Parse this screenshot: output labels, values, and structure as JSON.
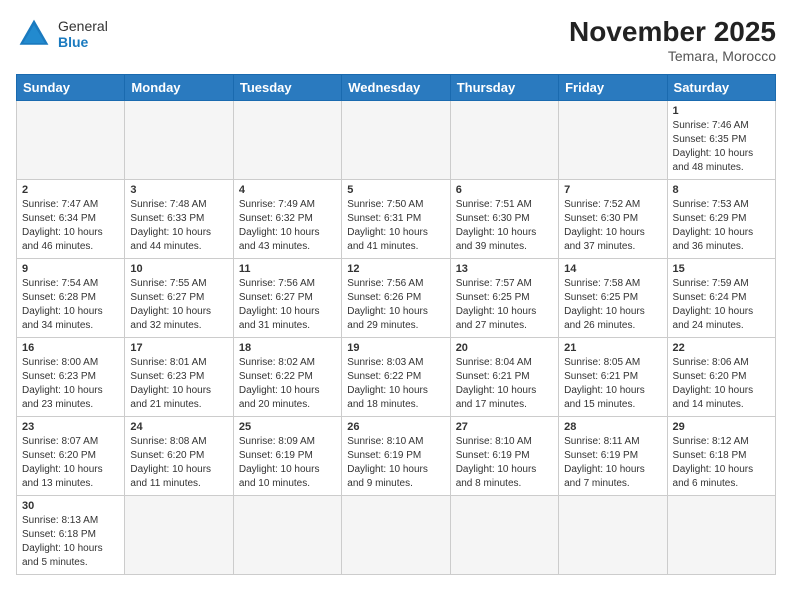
{
  "header": {
    "logo_general": "General",
    "logo_blue": "Blue",
    "month_title": "November 2025",
    "location": "Temara, Morocco"
  },
  "days_of_week": [
    "Sunday",
    "Monday",
    "Tuesday",
    "Wednesday",
    "Thursday",
    "Friday",
    "Saturday"
  ],
  "weeks": [
    [
      {
        "day": "",
        "info": ""
      },
      {
        "day": "",
        "info": ""
      },
      {
        "day": "",
        "info": ""
      },
      {
        "day": "",
        "info": ""
      },
      {
        "day": "",
        "info": ""
      },
      {
        "day": "",
        "info": ""
      },
      {
        "day": "1",
        "info": "Sunrise: 7:46 AM\nSunset: 6:35 PM\nDaylight: 10 hours\nand 48 minutes."
      }
    ],
    [
      {
        "day": "2",
        "info": "Sunrise: 7:47 AM\nSunset: 6:34 PM\nDaylight: 10 hours\nand 46 minutes."
      },
      {
        "day": "3",
        "info": "Sunrise: 7:48 AM\nSunset: 6:33 PM\nDaylight: 10 hours\nand 44 minutes."
      },
      {
        "day": "4",
        "info": "Sunrise: 7:49 AM\nSunset: 6:32 PM\nDaylight: 10 hours\nand 43 minutes."
      },
      {
        "day": "5",
        "info": "Sunrise: 7:50 AM\nSunset: 6:31 PM\nDaylight: 10 hours\nand 41 minutes."
      },
      {
        "day": "6",
        "info": "Sunrise: 7:51 AM\nSunset: 6:30 PM\nDaylight: 10 hours\nand 39 minutes."
      },
      {
        "day": "7",
        "info": "Sunrise: 7:52 AM\nSunset: 6:30 PM\nDaylight: 10 hours\nand 37 minutes."
      },
      {
        "day": "8",
        "info": "Sunrise: 7:53 AM\nSunset: 6:29 PM\nDaylight: 10 hours\nand 36 minutes."
      }
    ],
    [
      {
        "day": "9",
        "info": "Sunrise: 7:54 AM\nSunset: 6:28 PM\nDaylight: 10 hours\nand 34 minutes."
      },
      {
        "day": "10",
        "info": "Sunrise: 7:55 AM\nSunset: 6:27 PM\nDaylight: 10 hours\nand 32 minutes."
      },
      {
        "day": "11",
        "info": "Sunrise: 7:56 AM\nSunset: 6:27 PM\nDaylight: 10 hours\nand 31 minutes."
      },
      {
        "day": "12",
        "info": "Sunrise: 7:56 AM\nSunset: 6:26 PM\nDaylight: 10 hours\nand 29 minutes."
      },
      {
        "day": "13",
        "info": "Sunrise: 7:57 AM\nSunset: 6:25 PM\nDaylight: 10 hours\nand 27 minutes."
      },
      {
        "day": "14",
        "info": "Sunrise: 7:58 AM\nSunset: 6:25 PM\nDaylight: 10 hours\nand 26 minutes."
      },
      {
        "day": "15",
        "info": "Sunrise: 7:59 AM\nSunset: 6:24 PM\nDaylight: 10 hours\nand 24 minutes."
      }
    ],
    [
      {
        "day": "16",
        "info": "Sunrise: 8:00 AM\nSunset: 6:23 PM\nDaylight: 10 hours\nand 23 minutes."
      },
      {
        "day": "17",
        "info": "Sunrise: 8:01 AM\nSunset: 6:23 PM\nDaylight: 10 hours\nand 21 minutes."
      },
      {
        "day": "18",
        "info": "Sunrise: 8:02 AM\nSunset: 6:22 PM\nDaylight: 10 hours\nand 20 minutes."
      },
      {
        "day": "19",
        "info": "Sunrise: 8:03 AM\nSunset: 6:22 PM\nDaylight: 10 hours\nand 18 minutes."
      },
      {
        "day": "20",
        "info": "Sunrise: 8:04 AM\nSunset: 6:21 PM\nDaylight: 10 hours\nand 17 minutes."
      },
      {
        "day": "21",
        "info": "Sunrise: 8:05 AM\nSunset: 6:21 PM\nDaylight: 10 hours\nand 15 minutes."
      },
      {
        "day": "22",
        "info": "Sunrise: 8:06 AM\nSunset: 6:20 PM\nDaylight: 10 hours\nand 14 minutes."
      }
    ],
    [
      {
        "day": "23",
        "info": "Sunrise: 8:07 AM\nSunset: 6:20 PM\nDaylight: 10 hours\nand 13 minutes."
      },
      {
        "day": "24",
        "info": "Sunrise: 8:08 AM\nSunset: 6:20 PM\nDaylight: 10 hours\nand 11 minutes."
      },
      {
        "day": "25",
        "info": "Sunrise: 8:09 AM\nSunset: 6:19 PM\nDaylight: 10 hours\nand 10 minutes."
      },
      {
        "day": "26",
        "info": "Sunrise: 8:10 AM\nSunset: 6:19 PM\nDaylight: 10 hours\nand 9 minutes."
      },
      {
        "day": "27",
        "info": "Sunrise: 8:10 AM\nSunset: 6:19 PM\nDaylight: 10 hours\nand 8 minutes."
      },
      {
        "day": "28",
        "info": "Sunrise: 8:11 AM\nSunset: 6:19 PM\nDaylight: 10 hours\nand 7 minutes."
      },
      {
        "day": "29",
        "info": "Sunrise: 8:12 AM\nSunset: 6:18 PM\nDaylight: 10 hours\nand 6 minutes."
      }
    ],
    [
      {
        "day": "30",
        "info": "Sunrise: 8:13 AM\nSunset: 6:18 PM\nDaylight: 10 hours\nand 5 minutes."
      },
      {
        "day": "",
        "info": ""
      },
      {
        "day": "",
        "info": ""
      },
      {
        "day": "",
        "info": ""
      },
      {
        "day": "",
        "info": ""
      },
      {
        "day": "",
        "info": ""
      },
      {
        "day": "",
        "info": ""
      }
    ]
  ]
}
